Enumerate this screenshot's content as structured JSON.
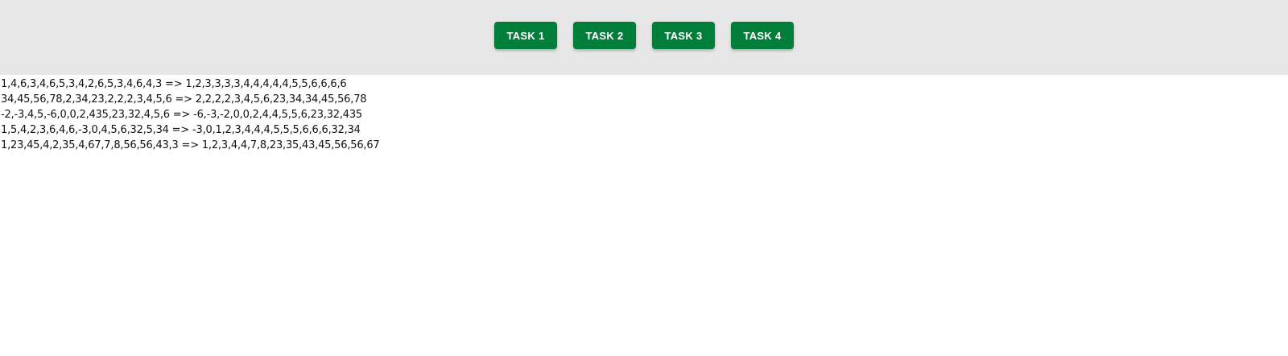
{
  "header": {
    "buttons": [
      {
        "label": "TASK 1"
      },
      {
        "label": "TASK 2"
      },
      {
        "label": "TASK 3"
      },
      {
        "label": "TASK 4"
      }
    ]
  },
  "output": {
    "lines": [
      "1,4,6,3,4,6,5,3,4,2,6,5,3,4,6,4,3 => 1,2,3,3,3,3,4,4,4,4,4,5,5,6,6,6,6",
      "34,45,56,78,2,34,23,2,2,2,3,4,5,6 => 2,2,2,2,3,4,5,6,23,34,34,45,56,78",
      "-2,-3,4,5,-6,0,0,2,435,23,32,4,5,6 => -6,-3,-2,0,0,2,4,4,5,5,6,23,32,435",
      "1,5,4,2,3,6,4,6,-3,0,4,5,6,32,5,34 => -3,0,1,2,3,4,4,4,5,5,5,6,6,6,32,34",
      "1,23,45,4,2,35,4,67,7,8,56,56,43,3 => 1,2,3,4,4,7,8,23,35,43,45,56,56,67"
    ]
  },
  "colors": {
    "header_bg": "#e7e7e7",
    "button_bg": "#007e3a",
    "button_text": "#ffffff"
  }
}
